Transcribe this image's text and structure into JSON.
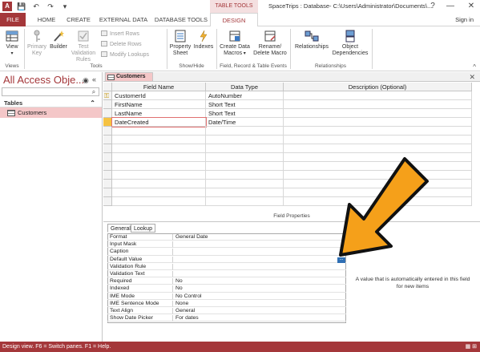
{
  "titlebar": {
    "app_icon": "A",
    "context_tab_label": "TABLE TOOLS",
    "window_title": "SpaceTrips : Database- C:\\Users\\Administrator\\Documents\\...",
    "help": "?",
    "minimize": "—",
    "maximize": "☐",
    "close": "✕"
  },
  "tabs": {
    "file": "FILE",
    "home": "HOME",
    "create": "CREATE",
    "external": "EXTERNAL DATA",
    "dbtools": "DATABASE TOOLS",
    "design": "DESIGN",
    "signin": "Sign in"
  },
  "ribbon": {
    "view": "View",
    "primary_key": "Primary Key",
    "builder": "Builder",
    "test_rules": "Test Validation Rules",
    "insert_rows": "Insert Rows",
    "delete_rows": "Delete Rows",
    "modify_lookups": "Modify Lookups",
    "property_sheet": "Property Sheet",
    "indexes": "Indexes",
    "create_data_macros": "Create Data Macros",
    "rename_delete_macro": "Rename/ Delete Macro",
    "relationships": "Relationships",
    "object_dependencies": "Object Dependencies",
    "groups": {
      "views": "Views",
      "tools": "Tools",
      "show_hide": "Show/Hide",
      "field_events": "Field, Record & Table Events",
      "relationships": "Relationships"
    }
  },
  "nav": {
    "title": "All Access Obje...",
    "section": "Tables",
    "item": "Customers"
  },
  "doc_tab": {
    "label": "Customers",
    "close": "✕"
  },
  "grid": {
    "headers": [
      "Field Name",
      "Data Type",
      "Description (Optional)"
    ],
    "rows": [
      {
        "name": "CustomerId",
        "type": "AutoNumber"
      },
      {
        "name": "FirstName",
        "type": "Short Text"
      },
      {
        "name": "LastName",
        "type": "Short Text"
      },
      {
        "name": "DateCreated",
        "type": "Date/Time"
      }
    ]
  },
  "field_properties": {
    "label": "Field Properties",
    "tab_general": "General",
    "tab_lookup": "Lookup",
    "rows": [
      {
        "name": "Format",
        "value": "General Date"
      },
      {
        "name": "Input Mask",
        "value": ""
      },
      {
        "name": "Caption",
        "value": ""
      },
      {
        "name": "Default Value",
        "value": ""
      },
      {
        "name": "Validation Rule",
        "value": ""
      },
      {
        "name": "Validation Text",
        "value": ""
      },
      {
        "name": "Required",
        "value": "No"
      },
      {
        "name": "Indexed",
        "value": "No"
      },
      {
        "name": "IME Mode",
        "value": "No Control"
      },
      {
        "name": "IME Sentence Mode",
        "value": "None"
      },
      {
        "name": "Text Align",
        "value": "General"
      },
      {
        "name": "Show Date Picker",
        "value": "For dates"
      }
    ],
    "builder_dots": "...",
    "help_text": "A value that is automatically entered in this field for new items"
  },
  "status": {
    "text": "Design view.  F6 = Switch panes.  F1 = Help."
  },
  "colors": {
    "accent": "#a4373a",
    "arrow": "#f5a01a"
  }
}
